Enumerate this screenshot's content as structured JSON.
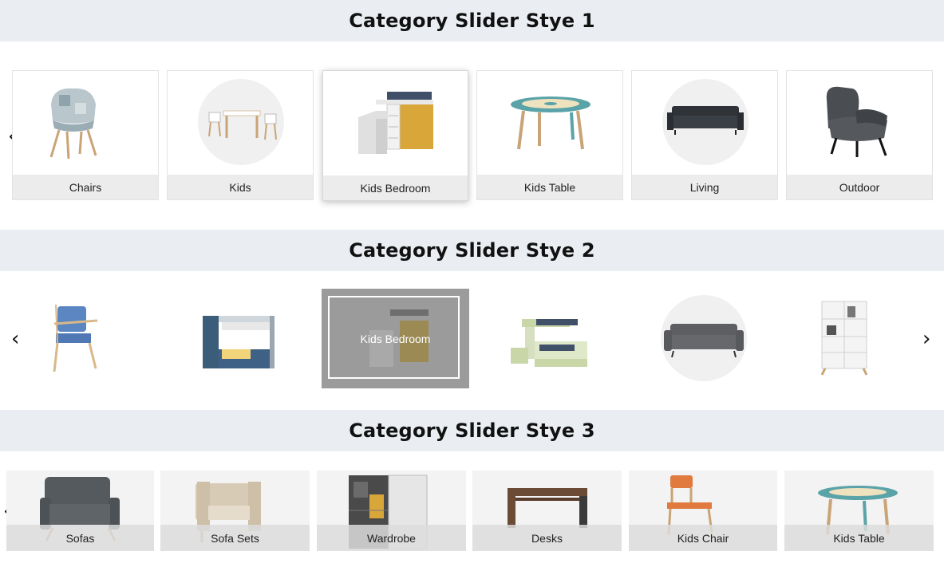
{
  "style1": {
    "title": "Category Slider Stye 1",
    "items": [
      {
        "label": "Chairs",
        "icon": "armchair-patchwork-icon"
      },
      {
        "label": "Kids",
        "icon": "kids-table-set-icon"
      },
      {
        "label": "Kids Bedroom",
        "icon": "loft-bed-icon"
      },
      {
        "label": "Kids Table",
        "icon": "round-table-icon"
      },
      {
        "label": "Living",
        "icon": "sofa-icon"
      },
      {
        "label": "Outdoor",
        "icon": "lounge-chair-icon"
      }
    ],
    "active_label": "Kids Bedroom"
  },
  "style2": {
    "title": "Category Slider Stye 2",
    "items": [
      {
        "icon": "blue-armchair-icon"
      },
      {
        "icon": "bunk-bed-icon"
      },
      {
        "label": "Kids Bedroom",
        "icon": "loft-bed-icon"
      },
      {
        "icon": "green-bunk-bed-icon"
      },
      {
        "icon": "grey-sofa-icon"
      },
      {
        "icon": "bookshelf-icon"
      }
    ],
    "active_label": "Kids Bedroom"
  },
  "style3": {
    "title": "Category Slider Stye 3",
    "items": [
      {
        "label": "Sofas",
        "icon": "armchair-grey-icon"
      },
      {
        "label": "Sofa Sets",
        "icon": "beige-armchair-icon"
      },
      {
        "label": "Wardrobe",
        "icon": "wardrobe-icon"
      },
      {
        "label": "Desks",
        "icon": "desk-icon"
      },
      {
        "label": "Kids Chair",
        "icon": "kids-chair-icon"
      },
      {
        "label": "Kids Table",
        "icon": "round-table-icon"
      }
    ]
  },
  "arrows": {
    "prev": "‹",
    "next": "›"
  },
  "colors": {
    "band": "#eaeef2",
    "label_bg": "#ececec",
    "active_overlay": "#9b9b9b",
    "teal": "#5aa3a8"
  }
}
